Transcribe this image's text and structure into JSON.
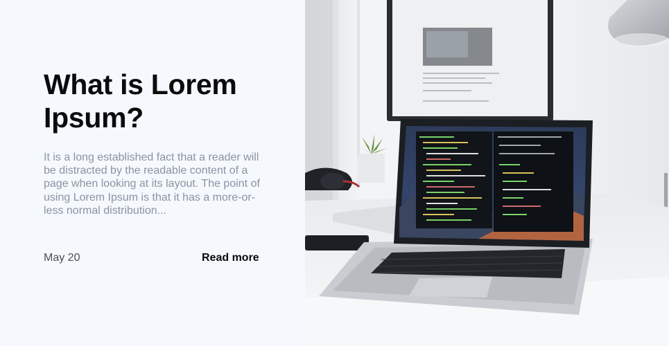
{
  "post": {
    "title": "What is Lorem Ipsum?",
    "excerpt": "It is a long established fact that a reader will be distracted by the readable content of a page when looking at its layout. The point of using Lorem Ipsum is that it has a more-or-less normal distribution...",
    "date": "May 20",
    "read_more_label": "Read more"
  },
  "image": {
    "description_icon": "laptop-desk-photo"
  },
  "colors": {
    "background": "#f5f8fc",
    "title": "#0b0b0b",
    "excerpt": "#8a94a3",
    "date": "#4a4f57"
  }
}
